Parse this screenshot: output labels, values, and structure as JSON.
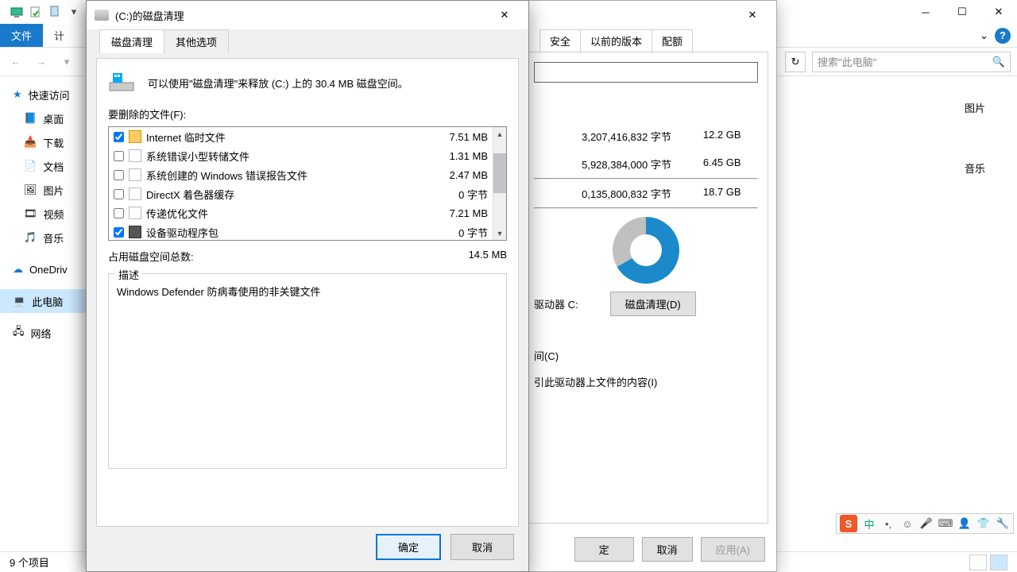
{
  "explorer": {
    "ribbon": {
      "file": "文件",
      "compute": "计",
      "expand": "⌄"
    },
    "nav": {
      "back": "←",
      "fwd": "→",
      "refresh": "↻"
    },
    "search": {
      "placeholder": "搜索\"此电脑\""
    },
    "tree": {
      "quick": "快速访问",
      "desktop": "桌面",
      "downloads": "下载",
      "documents": "文档",
      "pictures": "图片",
      "videos": "视频",
      "music": "音乐",
      "onedrive": "OneDriv",
      "thispc": "此电脑",
      "network": "网络"
    },
    "status": "9 个项目",
    "content_right": {
      "pics": "图片",
      "music_r": "音乐"
    }
  },
  "prop": {
    "tabs": {
      "security": "安全",
      "prev": "以前的版本",
      "quota": "配额"
    },
    "rows": [
      {
        "bytes": "3,207,416,832 字节",
        "gb": "12.2 GB"
      },
      {
        "bytes": "5,928,384,000 字节",
        "gb": "6.45 GB"
      },
      {
        "bytes": "0,135,800,832 字节",
        "gb": "18.7 GB"
      }
    ],
    "drive_label": "驱动器 C:",
    "cleanup": "磁盘清理(D)",
    "compress": "间(C)",
    "index": "引此驱动器上文件的内容(I)",
    "ok": "定",
    "cancel": "取消",
    "apply": "应用(A)"
  },
  "dc": {
    "title": "(C:)的磁盘清理",
    "tabs": {
      "main": "磁盘清理",
      "more": "其他选项"
    },
    "intro": "可以使用\"磁盘清理\"来释放  (C:) 上的 30.4 MB 磁盘空间。",
    "files_label": "要删除的文件(F):",
    "files": [
      {
        "checked": true,
        "icon": "lock",
        "name": "Internet 临时文件",
        "size": "7.51 MB"
      },
      {
        "checked": false,
        "icon": "file",
        "name": "系统错误小型转储文件",
        "size": "1.31 MB"
      },
      {
        "checked": false,
        "icon": "file",
        "name": "系统创建的 Windows 错误报告文件",
        "size": "2.47 MB"
      },
      {
        "checked": false,
        "icon": "file",
        "name": "DirectX 着色器缓存",
        "size": "0 字节"
      },
      {
        "checked": false,
        "icon": "file",
        "name": "传递优化文件",
        "size": "7.21 MB"
      },
      {
        "checked": true,
        "icon": "dark",
        "name": "设备驱动程序包",
        "size": "0 字节"
      }
    ],
    "total_label": "占用磁盘空间总数:",
    "total_size": "14.5 MB",
    "desc_label": "描述",
    "desc_text": "Windows Defender 防病毒使用的非关键文件",
    "ok": "确定",
    "cancel": "取消"
  },
  "ime": {
    "logo": "S",
    "cn": "中"
  }
}
